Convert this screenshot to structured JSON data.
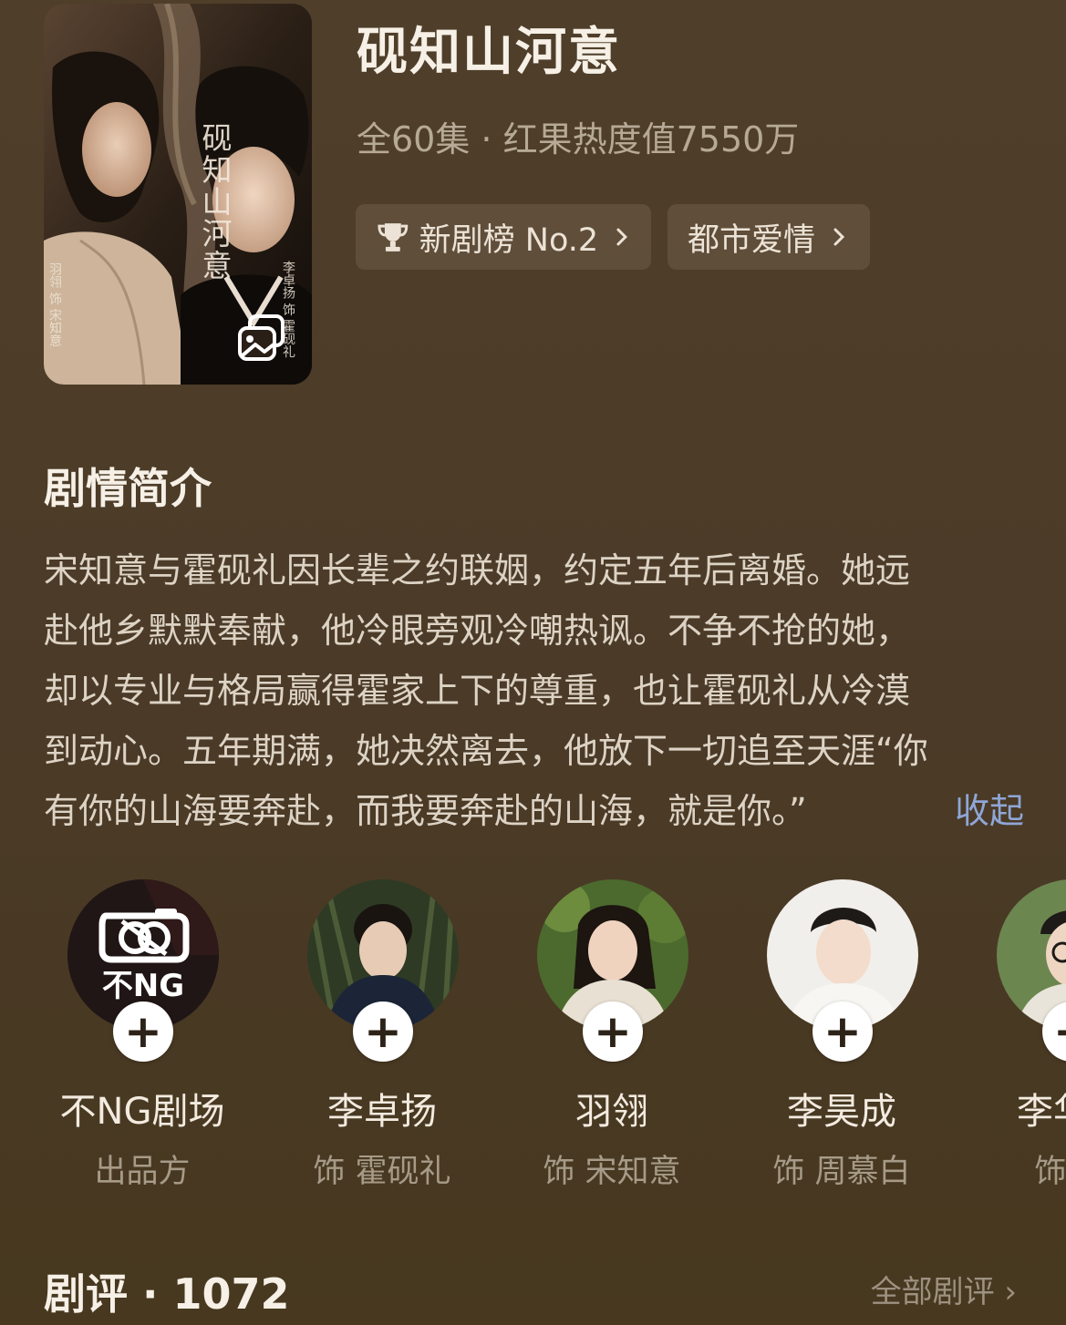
{
  "poster": {
    "title": "砚知山河意",
    "credit_left": "羽翎 饰 宋知意",
    "credit_right": "李卓扬 饰 霍砚礼",
    "gallery_icon": "image-gallery-icon"
  },
  "show": {
    "title": "砚知山河意",
    "meta": "全60集 · 红果热度值7550万",
    "tags": [
      {
        "label": "新剧榜 No.2",
        "icon": "trophy-icon"
      },
      {
        "label": "都市爱情"
      }
    ]
  },
  "synopsis": {
    "heading": "剧情简介",
    "lines": [
      "宋知意与霍砚礼因长辈之约联姻，约定五年后离婚。她远",
      "赴他乡默默奉献，他冷眼旁观冷嘲热讽。不争不抢的她，",
      "却以专业与格局赢得霍家上下的尊重，也让霍砚礼从冷漠",
      "到动心。五年期满，她决然离去，他放下一切追至天涯“你",
      "有你的山海要奔赴，而我要奔赴的山海，就是你。”"
    ],
    "collapse_label": "收起"
  },
  "cast": [
    {
      "name": "不NG剧场",
      "role": "出品方",
      "logo_text": "不NG"
    },
    {
      "name": "李卓扬",
      "role": "饰 霍砚礼"
    },
    {
      "name": "羽翎",
      "role": "饰 宋知意"
    },
    {
      "name": "李昊成",
      "role": "饰 周慕白"
    },
    {
      "name": "李华宇",
      "role": "饰 李"
    }
  ],
  "follow_symbol": "+",
  "reviews": {
    "title": "剧评 · 1072",
    "all_label": "全部剧评 ›"
  },
  "colors": {
    "background": "#4a3b27",
    "link": "#8fa6d6",
    "muted": "#a69a88"
  }
}
